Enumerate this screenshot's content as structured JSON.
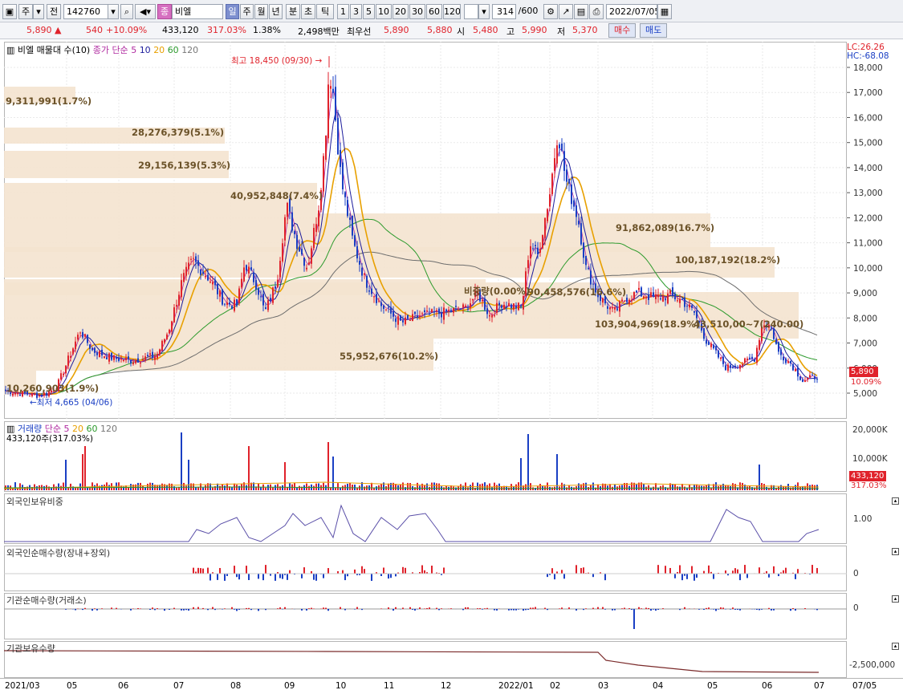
{
  "toolbar": {
    "market": "주",
    "prev": "전",
    "code": "142760",
    "name_tag": "종",
    "name": "비엘",
    "periods": [
      "일",
      "주",
      "월",
      "년",
      "분",
      "초",
      "틱"
    ],
    "active_period": "일",
    "minutes": [
      "1",
      "3",
      "5",
      "10",
      "20",
      "30",
      "60",
      "120"
    ],
    "count": "314",
    "count_total": "/600",
    "date": "2022/07/05"
  },
  "quote": {
    "price": "5,890",
    "change": "540",
    "change_pct": "+10.09%",
    "volume": "433,120",
    "volume_pct": "317.03%",
    "turnover": "1.38%",
    "amount": "2,498백만",
    "priority_label": "최우선",
    "ask": "5,890",
    "bid": "5,880",
    "open_label": "시",
    "open": "5,480",
    "high_label": "고",
    "high": "5,990",
    "low_label": "저",
    "low": "5,370",
    "buy": "매수",
    "sell": "매도"
  },
  "price_panel": {
    "title1": "비엘 매물대 수(10)",
    "title2": "종가 단순",
    "ma_labels": [
      "5",
      "10",
      "20",
      "60",
      "120"
    ],
    "lc": "LC:26.26",
    "hc": "HC:-68.08",
    "high_note": "최고 18,450 (09/30)",
    "low_note": "최저 4,665 (04/06)",
    "cur_price": "5,890",
    "cur_pct": "10.09%",
    "y_ticks": [
      "18,000",
      "17,000",
      "16,000",
      "15,000",
      "14,000",
      "13,000",
      "12,000",
      "11,000",
      "10,000",
      "9,000",
      "8,000",
      "7,000",
      "6,000",
      "5,000"
    ],
    "volume_profile": [
      {
        "label": "9,311,991(1.7%)"
      },
      {
        "label": "28,276,379(5.1%)"
      },
      {
        "label": "29,156,139(5.3%)"
      },
      {
        "label": "40,952,848(7.4%)"
      },
      {
        "label": "91,862,089(16.7%)"
      },
      {
        "label": "100,187,192(18.2%)"
      },
      {
        "label": "비중량(0.00%)"
      },
      {
        "label": "90,458,576(16.6%)"
      },
      {
        "label": "103,904,969(18.9%)"
      },
      {
        "label": "43,510,00~7(240.00)"
      },
      {
        "label": "55,952,676(10.2%)"
      },
      {
        "label": "10,260,903(1.9%)"
      }
    ]
  },
  "volume_panel": {
    "title": "거래량",
    "title2": "단순",
    "ma_labels": [
      "5",
      "20",
      "60",
      "120"
    ],
    "sub": "433,120주(317.03%)",
    "y_ticks": [
      "20,000K",
      "10,000K"
    ],
    "cur_vol": "433,120",
    "cur_pct": "317.03%"
  },
  "foreign_ratio": {
    "title": "외국인보유비중",
    "tick": "1.00"
  },
  "foreign_net": {
    "title": "외국인순매수량(장내+장외)",
    "tick": "0"
  },
  "inst_net": {
    "title": "기관순매수량(거래소)",
    "tick": "0"
  },
  "inst_hold": {
    "title": "기관보유수량",
    "tick": "-2,500,000"
  },
  "x_axis": [
    "2021/03",
    "05",
    "06",
    "07",
    "08",
    "09",
    "10",
    "11",
    "12",
    "2022/01",
    "02",
    "03",
    "04",
    "05",
    "06",
    "07",
    "07/05"
  ],
  "colors": {
    "up": "#e0222b",
    "down": "#1a3fc4",
    "ma5": "#1c1c9c",
    "ma20": "#e8a000",
    "ma60": "#2c9a2c",
    "ma120": "#6d6d6d",
    "profile": "#f4e3cf"
  }
}
